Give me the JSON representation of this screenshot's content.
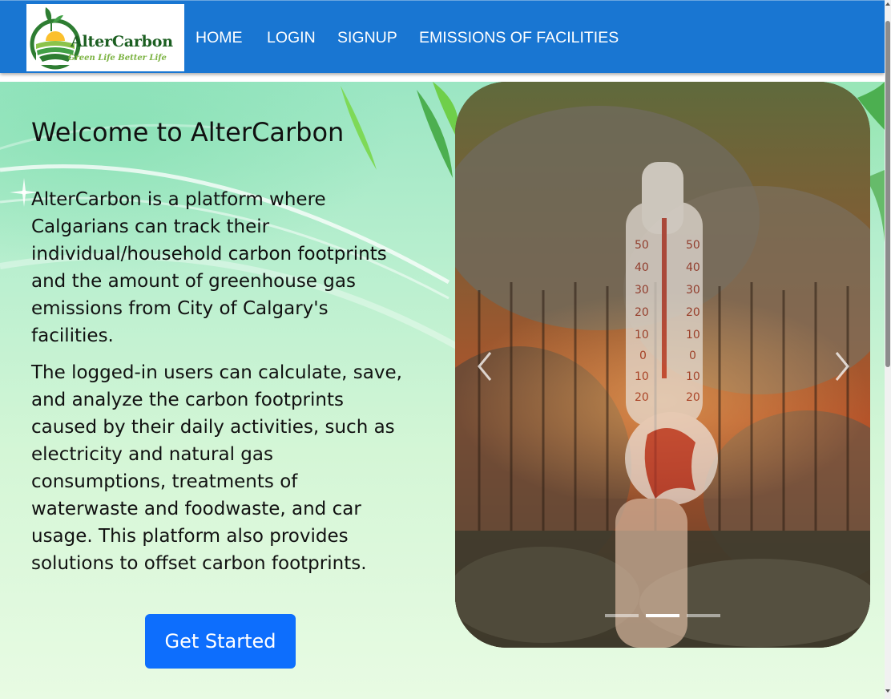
{
  "brand": {
    "name": "AlterCarbon",
    "tagline": "Green Life Better Life"
  },
  "nav": {
    "home": "HOME",
    "login": "LOGIN",
    "signup": "SIGNUP",
    "emissions": "EMISSIONS OF FACILITIES"
  },
  "hero": {
    "title": "Welcome to AlterCarbon",
    "paragraph1": "AlterCarbon is a platform where Calgarians can track their individual/household carbon footprints and the amount of greenhouse gas emissions from City of Calgary's facilities.",
    "paragraph2": "The logged-in users can calculate, save, and analyze the carbon footprints caused by their daily activities, such as electricity and natural gas consumptions, treatments of waterwaste and foodwaste, and car usage. This platform also provides solutions to offset carbon footprints.",
    "cta_label": "Get Started"
  },
  "carousel": {
    "slide_count": 3,
    "active_slide": 2,
    "prev_icon": "chevron-left-icon",
    "next_icon": "chevron-right-icon"
  },
  "colors": {
    "navbar": "#1976d2",
    "cta": "#0d6efd",
    "logo_green": "#1b5e20",
    "tagline_green": "#7cb342"
  }
}
